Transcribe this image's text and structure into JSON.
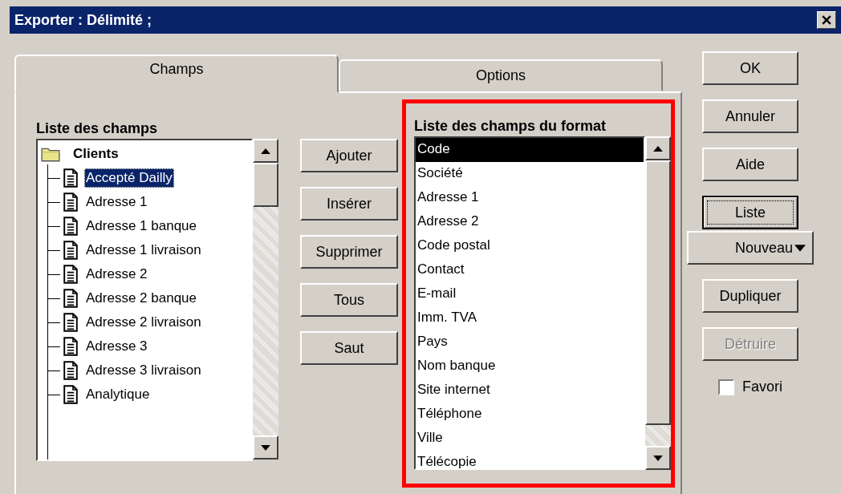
{
  "window": {
    "title": "Exporter : Délimité ;"
  },
  "tabs": [
    {
      "label": "Champs",
      "selected": true
    },
    {
      "label": "Options",
      "selected": false
    }
  ],
  "field_list": {
    "label": "Liste des champs",
    "tree": [
      {
        "label": "Clients",
        "expanded": true,
        "selected": false,
        "children": [
          {
            "label": "Accepté Dailly",
            "selected": true
          },
          {
            "label": "Adresse 1",
            "selected": false
          },
          {
            "label": "Adresse 1 banque",
            "selected": false
          },
          {
            "label": "Adresse 1 livraison",
            "selected": false
          },
          {
            "label": "Adresse 2",
            "selected": false
          },
          {
            "label": "Adresse 2 banque",
            "selected": false
          },
          {
            "label": "Adresse 2 livraison",
            "selected": false
          },
          {
            "label": "Adresse 3",
            "selected": false
          },
          {
            "label": "Adresse 3 livraison",
            "selected": false
          },
          {
            "label": "Analytique",
            "selected": false
          }
        ]
      }
    ]
  },
  "actions": [
    {
      "label": "Ajouter"
    },
    {
      "label": "Insérer"
    },
    {
      "label": "Supprimer"
    },
    {
      "label": "Tous"
    },
    {
      "label": "Saut"
    }
  ],
  "format_list": {
    "label": "Liste des champs du format",
    "items": [
      {
        "label": "Code",
        "selected": true
      },
      {
        "label": "Société",
        "selected": false
      },
      {
        "label": "Adresse 1",
        "selected": false
      },
      {
        "label": "Adresse 2",
        "selected": false
      },
      {
        "label": "Code postal",
        "selected": false
      },
      {
        "label": "Contact",
        "selected": false
      },
      {
        "label": "E-mail",
        "selected": false
      },
      {
        "label": "Imm. TVA",
        "selected": false
      },
      {
        "label": "Pays",
        "selected": false
      },
      {
        "label": "Nom banque",
        "selected": false
      },
      {
        "label": "Site internet",
        "selected": false
      },
      {
        "label": "Téléphone",
        "selected": false
      },
      {
        "label": "Ville",
        "selected": false
      },
      {
        "label": "Télécopie",
        "selected": false
      }
    ]
  },
  "buttons": [
    {
      "label": "OK",
      "kind": "push",
      "disabled": false,
      "focused": false
    },
    {
      "label": "Annuler",
      "kind": "push",
      "disabled": false,
      "focused": false
    },
    {
      "label": "Aide",
      "kind": "push",
      "disabled": false,
      "focused": false
    },
    {
      "label": "Liste",
      "kind": "push",
      "disabled": false,
      "focused": true
    },
    {
      "label": "Nouveau",
      "kind": "menu",
      "disabled": false,
      "focused": false
    },
    {
      "label": "Dupliquer",
      "kind": "push",
      "disabled": false,
      "focused": false
    },
    {
      "label": "Détruire",
      "kind": "push",
      "disabled": true,
      "focused": false
    }
  ],
  "favorite": {
    "label": "Favori",
    "checked": false
  }
}
